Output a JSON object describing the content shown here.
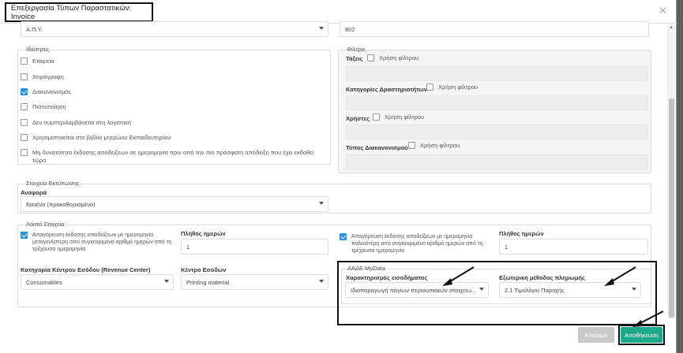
{
  "modal": {
    "title": "Επεξεργασία Τύπων Παραστατικών: Invoice"
  },
  "top": {
    "select_value": "Α.Π.Υ.",
    "code_value": "802"
  },
  "properties": {
    "legend": "Ιδιότητες",
    "items": [
      {
        "label": "Εταιρεία",
        "checked": false
      },
      {
        "label": "Χειρόγραφη",
        "checked": false
      },
      {
        "label": "Διακανονισμός",
        "checked": true
      },
      {
        "label": "Πιστοποίηση",
        "checked": false
      },
      {
        "label": "Δεν συμπεριλαμβάνεται στη λογιστική",
        "checked": false
      },
      {
        "label": "Χρησιμοποιείται στο βιβλίο μητρώου Εκπαιδευτηρίου",
        "checked": false
      },
      {
        "label": "Μη δυνατότητα έκδοσης αποδείξεων σε ημερομηνία πριν από την πιο πρόσφατη απόδειξη που έχει εκδοθεί τώρα",
        "checked": false
      }
    ]
  },
  "filters": {
    "legend": "Φίλτρα",
    "filter_use_label": "Χρήση φίλτρου",
    "groups": [
      {
        "label": "Τάξεις"
      },
      {
        "label": "Κατηγορίες Δραστηριοτήτων"
      },
      {
        "label": "Χρήστες"
      },
      {
        "label": "Τύπος Διακανονισμού"
      }
    ]
  },
  "print": {
    "legend": "Στοιχεία Εκτύπωσης",
    "report_label": "Αναφορά",
    "report_value": "Κανένα (προκαθορισμένο)"
  },
  "other": {
    "legend": "Λοιπά Στοιχεία",
    "later_date_label": "Απαγόρευση έκδοσης αποδείξεων με ημερομηνία μεταγενέστερη από συγκεκριμένο αριθμό ημερών από τη τρέχουσα ημερομηνία",
    "earlier_date_label": "Απαγόρευση έκδοσης αποδείξεων με ημερομηνία παλαιότερη από συγκεκριμένο αριθμό ημερών από τη τρέχουσα ημερομηνία",
    "days_label_1": "Πλήθος ημερών",
    "days_value_1": "1",
    "days_label_2": "Πλήθος ημερών",
    "days_value_2": "1",
    "revenue_category_label": "Κατηγορία Κέντρου Εσόδου (Revenue Center)",
    "revenue_category_value": "Consumables",
    "revenue_center_label": "Κέντρο Εσόδων",
    "revenue_center_value": "Printing material"
  },
  "aade": {
    "legend": "ΑΑΔΕ MyData",
    "income_label": "Χαρακτηρισμός εισοδήματος",
    "income_value": "Ιδιοπαραγωγή πάγιων περιουσιακών στοιχείω...",
    "payment_label": "Εξωτερική μέθοδος πληρωμής",
    "payment_value": "2.1 Τιμολόγιο Παροχής"
  },
  "footer": {
    "close_label": "Κλείσιμο",
    "save_label": "Αποθήκευση"
  },
  "colors": {
    "primary": "#1ea88a",
    "checkbox": "#2d8fd9",
    "disabled": "#c9c9c9"
  }
}
